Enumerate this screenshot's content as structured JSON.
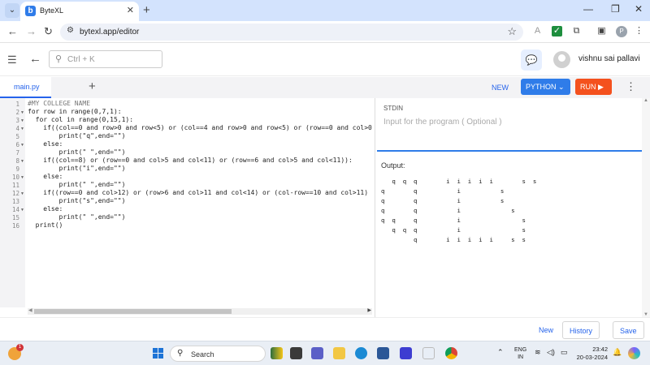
{
  "browser": {
    "tab_title": "ByteXL",
    "favicon_letter": "b",
    "url": "bytexl.app/editor",
    "profile_initial": "P"
  },
  "app": {
    "search_placeholder": "Ctrl + K",
    "username": "vishnu sai pallavi"
  },
  "editor": {
    "file_tab": "main.py",
    "new_label": "NEW",
    "language": "PYTHON",
    "run_label": "RUN",
    "code_lines": [
      "#MY COLLEGE NAME",
      "for row in range(0,7,1):",
      "  for col in range(0,15,1):",
      "    if((col==0 and row>0 and row<5) or (col==4 and row>0 and row<5) or (row==0 and col>0",
      "        print(\"q\",end=\"\")",
      "    else:",
      "        print(\" \",end=\"\")",
      "    if((col==8) or (row==0 and col>5 and col<11) or (row==6 and col>5 and col<11)):",
      "        print(\"i\",end=\"\")",
      "    else:",
      "        print(\" \",end=\"\")",
      "    if((row==0 and col>12) or (row>6 and col>11 and col<14) or (col-row==10 and col>11)",
      "        print(\"s\",end=\"\")",
      "    else:",
      "        print(\" \",end=\"\")",
      "  print()"
    ],
    "line_numbers": [
      "1",
      "2",
      "3",
      "4",
      "5",
      "6",
      "7",
      "8",
      "9",
      "10",
      "11",
      "12",
      "13",
      "14",
      "15",
      "16"
    ],
    "folded_lines": [
      2,
      3,
      4,
      6,
      8,
      10,
      12,
      14
    ]
  },
  "stdin": {
    "label": "STDIN",
    "placeholder": "Input for the program ( Optional )"
  },
  "output": {
    "label": "Output:",
    "lines": [
      "   q  q  q        i  i  i  i  i        s  s",
      "q        q           i           s",
      "q        q           i           s",
      "q        q           i              s",
      "q  q     q           i                 s",
      "   q  q  q           i                 s",
      "         q        i  i  i  i  i     s  s"
    ]
  },
  "actions": {
    "new": "New",
    "history": "History",
    "save": "Save"
  },
  "taskbar": {
    "search_label": "Search",
    "weather_badge": "1",
    "lang_top": "ENG",
    "lang_bottom": "IN",
    "time": "23:42",
    "date": "20-03-2024"
  },
  "colors": {
    "accent": "#2f7ce9",
    "run": "#f4511e"
  }
}
